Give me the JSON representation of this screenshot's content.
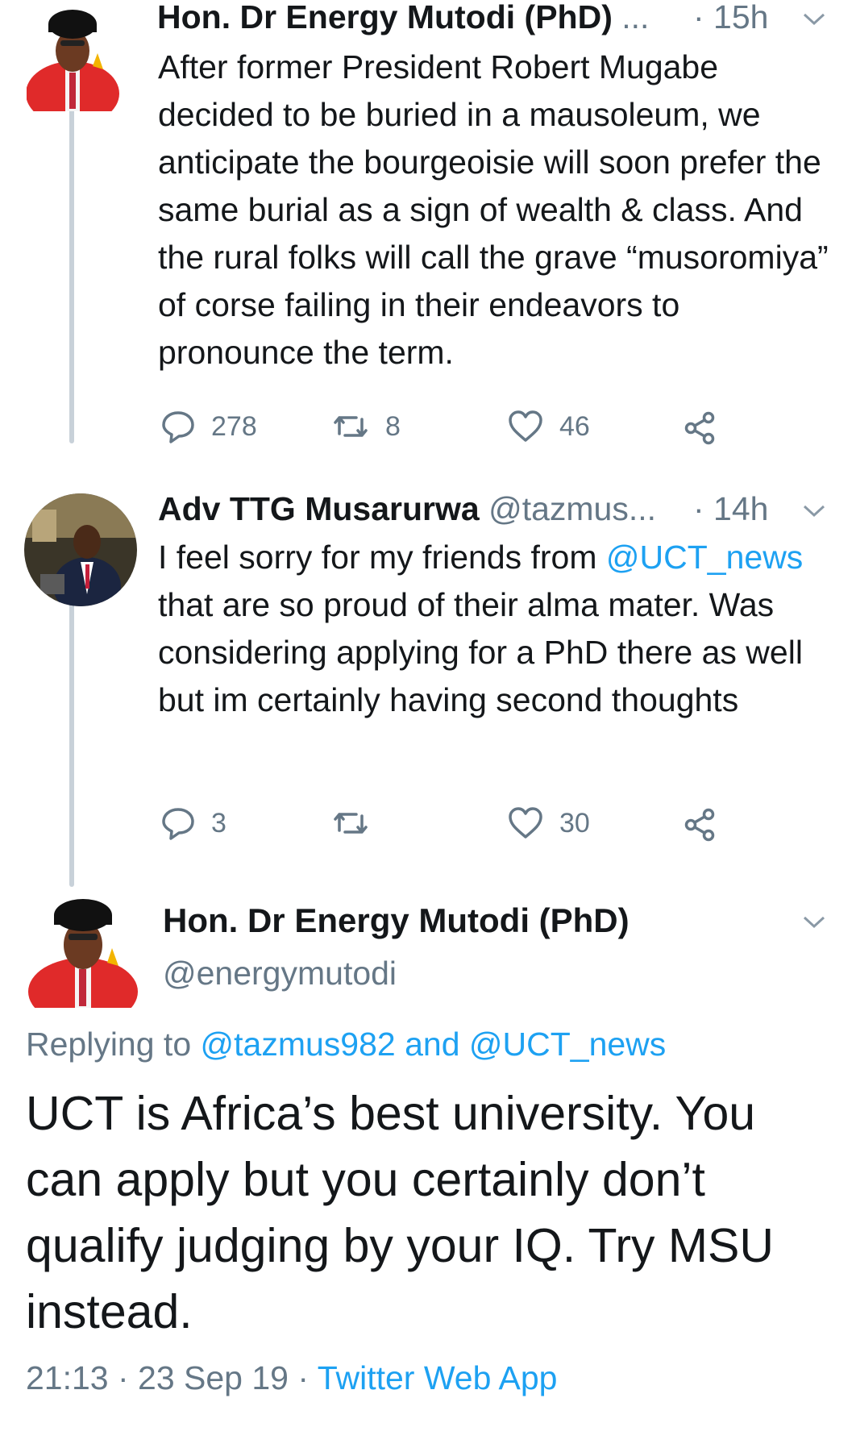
{
  "colors": {
    "link": "#1da1f2",
    "muted": "#657786",
    "text": "#14171a",
    "thread_line": "#c8d1d9"
  },
  "tweets": [
    {
      "name": "Hon. Dr Energy Mutodi (PhD)",
      "ellipsis": "...",
      "time": "· 15h",
      "avatar_icon": "profile-photo-academic-gown",
      "text": "After former President Robert Mugabe decided to be buried in a mausoleum, we anticipate the bourgeoisie will soon prefer the same burial as a sign of wealth & class. And the rural folks will call the grave “musoromiya” of corse failing in their endeavors to pronounce the term.",
      "replies": "278",
      "retweets": "8",
      "likes": "46"
    },
    {
      "name": "Adv TTG Musarurwa",
      "handle": "@tazmus...",
      "time": "· 14h",
      "avatar_icon": "profile-photo-suit",
      "text_before": "I feel sorry for my friends from ",
      "mention": "@UCT_news",
      "text_after": " that are so proud of their alma mater. Was considering applying for a PhD there as well but im certainly having second thoughts",
      "replies": "3",
      "retweets": "",
      "likes": "30"
    }
  ],
  "main": {
    "name": "Hon. Dr Energy Mutodi (PhD)",
    "handle": "@energymutodi",
    "replying_prefix": "Replying to ",
    "replying_to": "@tazmus982 and @UCT_news",
    "text": "UCT is Africa’s best university. You can apply but you certainly don’t qualify judging by your IQ. Try MSU instead.",
    "timestamp": "21:13 · 23 Sep 19 · ",
    "source": "Twitter Web App"
  },
  "icons": {
    "reply": "reply-icon",
    "retweet": "retweet-icon",
    "like": "heart-icon",
    "share": "share-icon",
    "more": "chevron-down-icon"
  }
}
